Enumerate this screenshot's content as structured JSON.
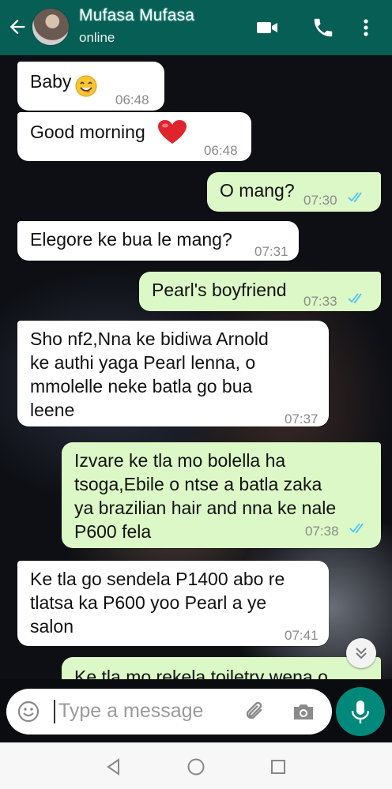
{
  "header": {
    "contact_name": "Mufasa Mufasa",
    "status": "online"
  },
  "messages": [
    {
      "direction": "incoming",
      "text": "Baby",
      "emoji": "smiling-face-icon",
      "time": "06:48"
    },
    {
      "direction": "incoming",
      "text": "Good morning",
      "emoji": "red-heart-icon",
      "time": "06:48"
    },
    {
      "direction": "outgoing",
      "text": "O mang?",
      "time": "07:30",
      "read": true
    },
    {
      "direction": "incoming",
      "text": "Elegore ke bua le mang?",
      "time": "07:31"
    },
    {
      "direction": "outgoing",
      "text": "Pearl's boyfriend",
      "time": "07:33",
      "read": true
    },
    {
      "direction": "incoming",
      "lines": [
        "Sho nf2,Nna ke bidiwa Arnold",
        "ke authi yaga Pearl lenna, o",
        "mmolelle neke  batla go bua",
        "leene"
      ],
      "time": "07:37"
    },
    {
      "direction": "outgoing",
      "lines": [
        "Izvare ke tla mo bolella ha",
        "tsoga,Ebile o ntse a batla zaka",
        "ya brazilian hair and nna ke nale",
        "P600 fela"
      ],
      "time": "07:38",
      "read": true
    },
    {
      "direction": "incoming",
      "lines": [
        "Ke tla go sendela P1400 abo re",
        "tlatsa ka P600 yoo Pearl a ye",
        "salon"
      ],
      "time": "07:41"
    },
    {
      "direction": "outgoing",
      "text": "Ke tla mo rekela toiletry wena o",
      "partial": true
    }
  ],
  "composer": {
    "placeholder": "Type a message"
  },
  "colors": {
    "header": "#075e54",
    "incoming_bubble": "#ffffff",
    "outgoing_bubble": "#dcf8c6",
    "read_ticks": "#4fc3f7",
    "mic_button": "#00897b"
  }
}
